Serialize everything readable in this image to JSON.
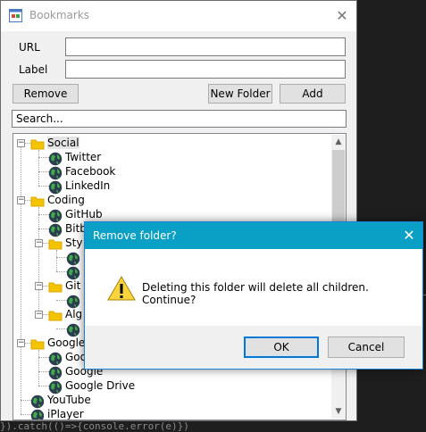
{
  "window": {
    "title": "Bookmarks",
    "close_glyph": "✕"
  },
  "form": {
    "url_label": "URL",
    "url_value": "",
    "label_label": "Label",
    "label_value": "",
    "remove_button": "Remove",
    "new_folder_button": "New Folder",
    "add_button": "Add",
    "search_value": "Search..."
  },
  "tree": {
    "nodes": [
      {
        "label": "Social",
        "type": "folder"
      },
      {
        "label": "Twitter",
        "type": "link"
      },
      {
        "label": "Facebook",
        "type": "link"
      },
      {
        "label": "LinkedIn",
        "type": "link"
      },
      {
        "label": "Coding",
        "type": "folder"
      },
      {
        "label": "GitHub",
        "type": "link"
      },
      {
        "label": "Bitb",
        "type": "link"
      },
      {
        "label": "Sty",
        "type": "folder"
      },
      {
        "label": "",
        "type": "link"
      },
      {
        "label": "",
        "type": "link"
      },
      {
        "label": "Git",
        "type": "folder"
      },
      {
        "label": "",
        "type": "link"
      },
      {
        "label": "Alg",
        "type": "folder"
      },
      {
        "label": "",
        "type": "link"
      },
      {
        "label": "Google",
        "type": "folder"
      },
      {
        "label": "Goo",
        "type": "link"
      },
      {
        "label": "Google",
        "type": "link"
      },
      {
        "label": "Google Drive",
        "type": "link"
      },
      {
        "label": "YouTube",
        "type": "link"
      },
      {
        "label": "iPlayer",
        "type": "link"
      }
    ]
  },
  "dialog": {
    "title": "Remove folder?",
    "close_glyph": "✕",
    "message": "Deleting this folder will delete all children. Continue?",
    "ok_button": "OK",
    "cancel_button": "Cancel"
  },
  "background": {
    "code_text": "}).catch(()=>{console.error(e)})"
  },
  "colors": {
    "dialog_title": "#0a9fc5",
    "accent": "#0078d7",
    "folder": "#f5c400"
  }
}
